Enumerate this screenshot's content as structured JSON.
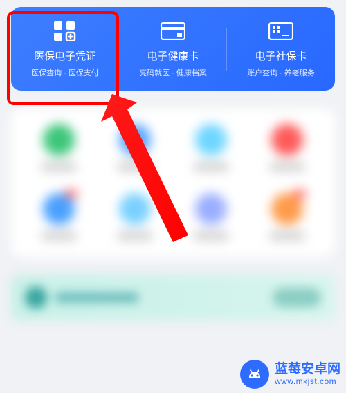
{
  "cards": [
    {
      "title": "医保电子凭证",
      "subtitle": "医保查询 · 医保支付",
      "icon": "qr-icon"
    },
    {
      "title": "电子健康卡",
      "subtitle": "亮码就医 · 健康档案",
      "icon": "card-icon"
    },
    {
      "title": "电子社保卡",
      "subtitle": "账户查询 · 养老服务",
      "icon": "plus-card-icon"
    }
  ],
  "watermark": {
    "title": "蓝莓安卓网",
    "url": "www.mkjst.com"
  },
  "colors": {
    "primary": "#2868ff",
    "highlight": "#ff0000"
  }
}
